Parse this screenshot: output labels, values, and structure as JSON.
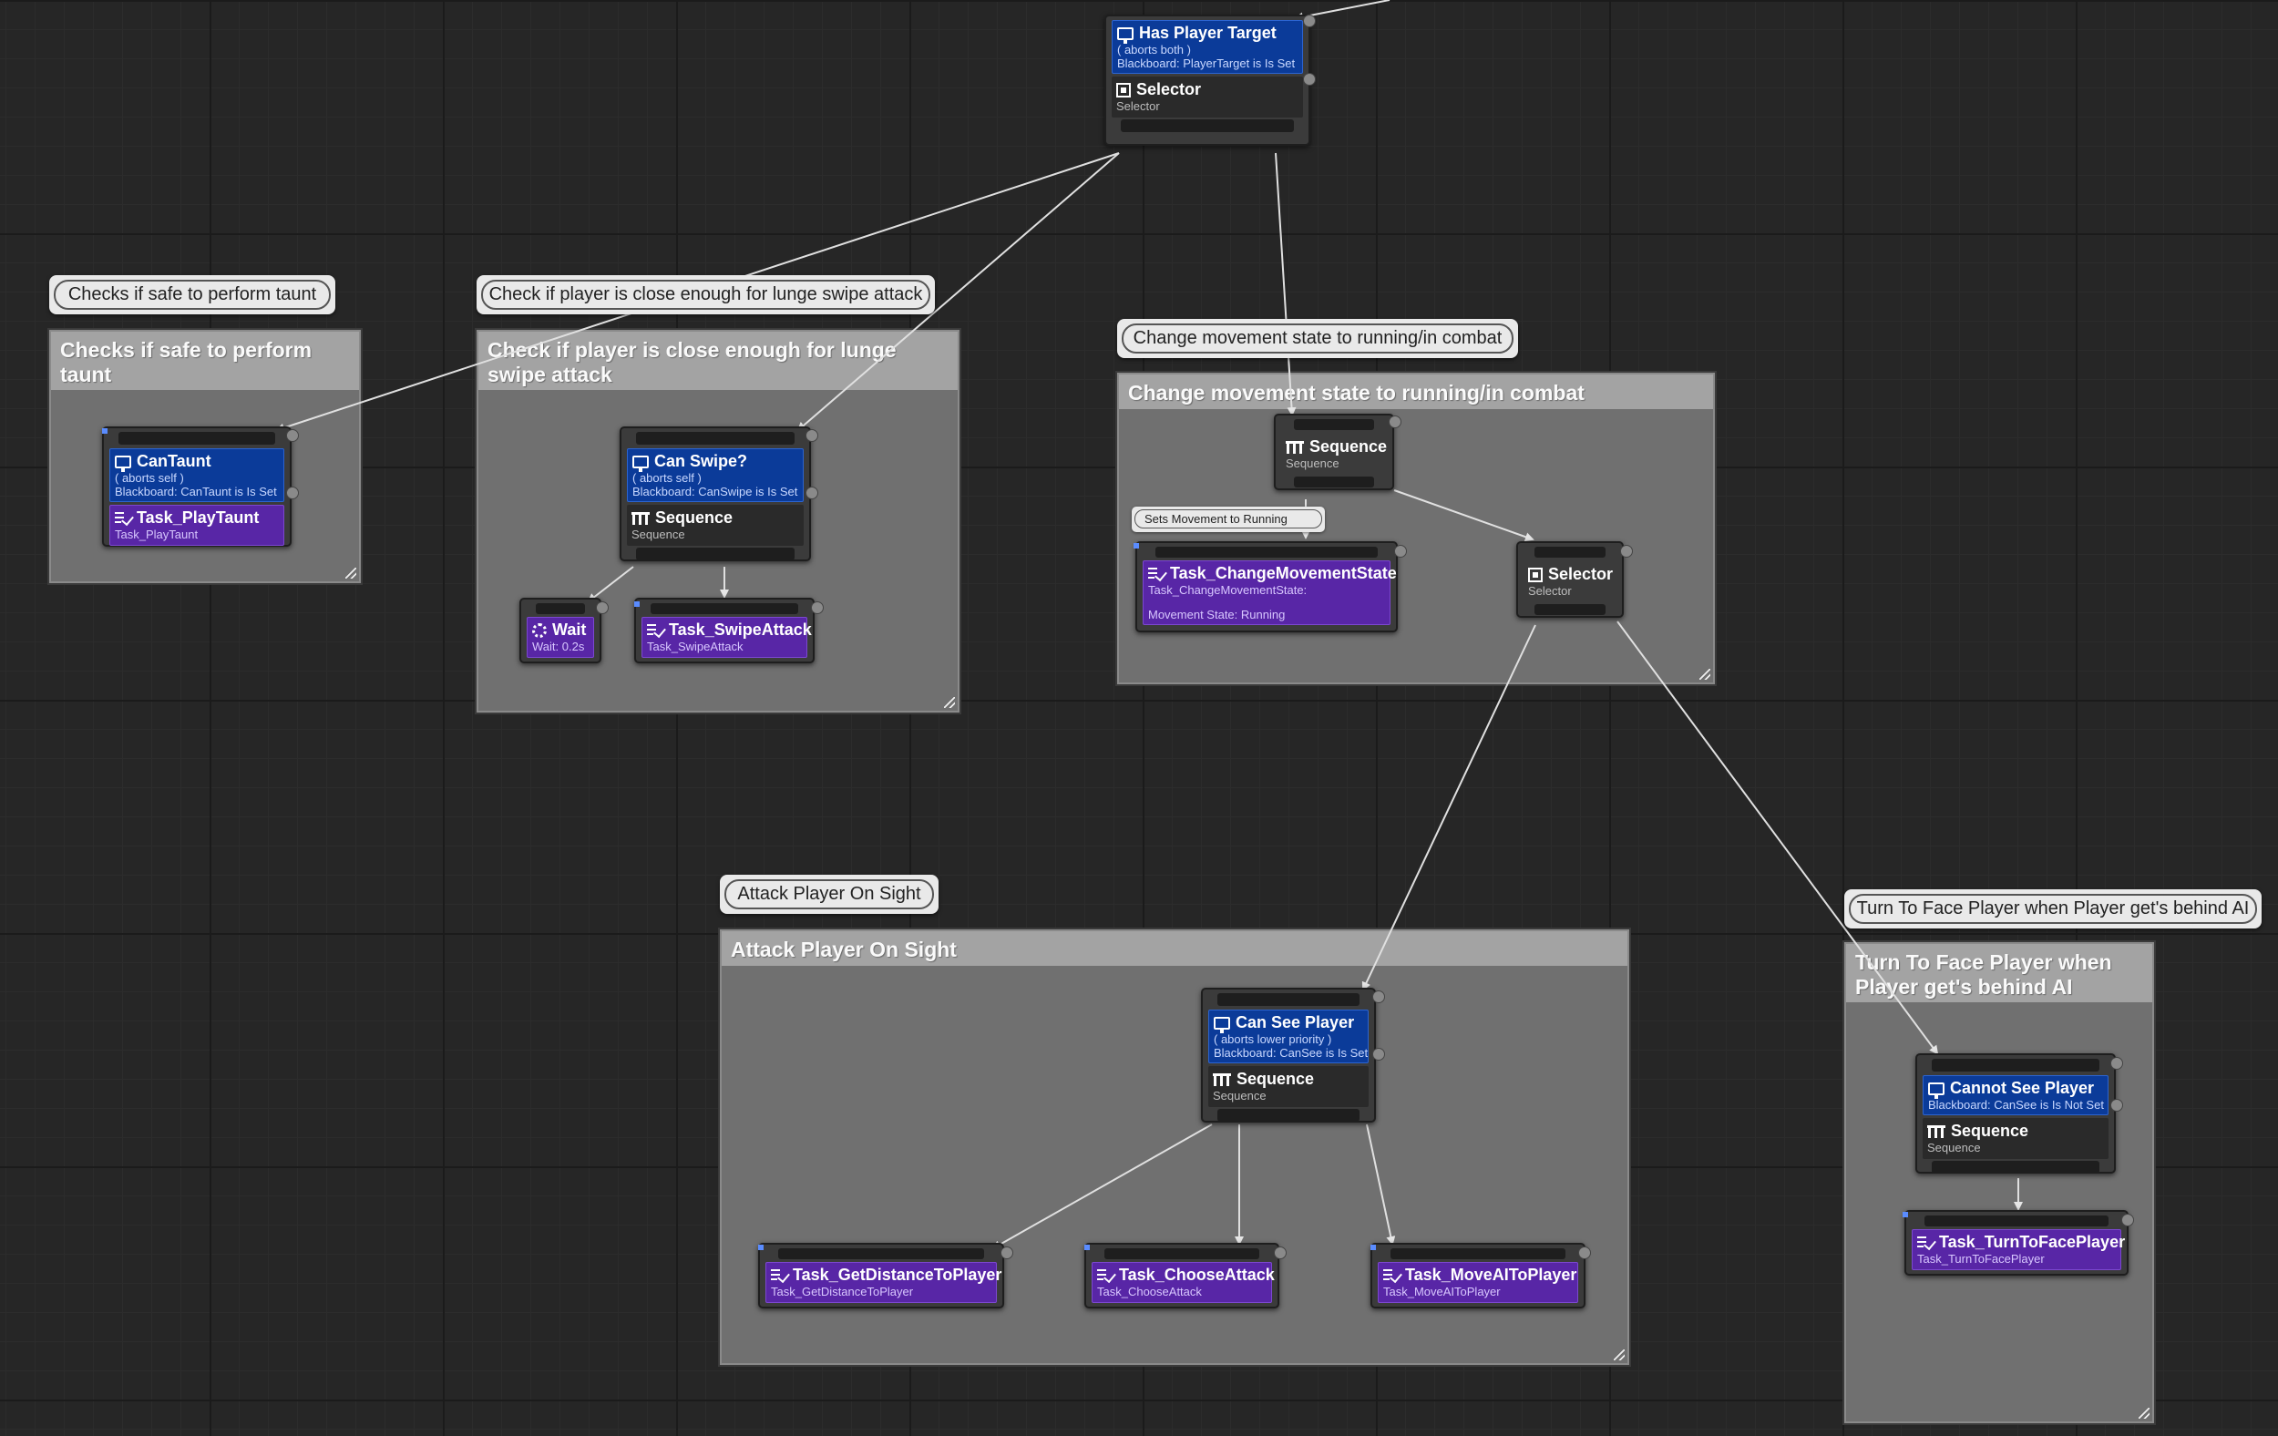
{
  "colors": {
    "graph_background": "#262626",
    "comment_body": "#707070",
    "comment_title": "#a3a3a3",
    "decorator": "#0b3b99",
    "task": "#5826a6",
    "composite": "#2a2a2a"
  },
  "bubbles": {
    "taunt": "Checks if safe to perform taunt",
    "lunge": "Check if player is close enough for lunge swipe attack",
    "movement": "Change movement state to running/in combat",
    "attack": "Attack Player On Sight",
    "turn": "Turn To Face Player when Player get's behind AI",
    "sets_movement": "Sets Movement to Running"
  },
  "comments": {
    "taunt": "Checks if safe to perform taunt",
    "lunge": "Check if player is close enough for lunge swipe attack",
    "movement": "Change movement state to running/in combat",
    "attack": "Attack Player On Sight",
    "turn": "Turn To Face Player when Player get's behind AI"
  },
  "nodes": {
    "root": {
      "decorator_title": "Has Player Target",
      "decorator_abort": "( aborts both )",
      "decorator_condition": "Blackboard: PlayerTarget is Is Set",
      "composite_title": "Selector",
      "composite_sub": "Selector"
    },
    "cantaunt": {
      "decorator_title": "CanTaunt",
      "decorator_abort": "( aborts self )",
      "decorator_condition": "Blackboard: CanTaunt is Is Set",
      "task_title": "Task_PlayTaunt",
      "task_sub": "Task_PlayTaunt"
    },
    "canswipe": {
      "decorator_title": "Can Swipe?",
      "decorator_abort": "( aborts self )",
      "decorator_condition": "Blackboard: CanSwipe is Is Set",
      "composite_title": "Sequence",
      "composite_sub": "Sequence"
    },
    "wait": {
      "title": "Wait",
      "sub": "Wait: 0.2s"
    },
    "swipe": {
      "title": "Task_SwipeAttack",
      "sub": "Task_SwipeAttack"
    },
    "move_seq": {
      "title": "Sequence",
      "sub": "Sequence"
    },
    "change_state": {
      "title": "Task_ChangeMovementState",
      "sub": "Task_ChangeMovementState:",
      "detail": "Movement State: Running"
    },
    "selector2": {
      "title": "Selector",
      "sub": "Selector"
    },
    "cansee": {
      "decorator_title": "Can See Player",
      "decorator_abort": "( aborts lower priority )",
      "decorator_condition": "Blackboard: CanSee is Is Set",
      "composite_title": "Sequence",
      "composite_sub": "Sequence"
    },
    "getdist": {
      "title": "Task_GetDistanceToPlayer",
      "sub": "Task_GetDistanceToPlayer"
    },
    "choose": {
      "title": "Task_ChooseAttack",
      "sub": "Task_ChooseAttack"
    },
    "moveai": {
      "title": "Task_MoveAIToPlayer",
      "sub": "Task_MoveAIToPlayer"
    },
    "cannotsee": {
      "decorator_title": "Cannot See Player",
      "decorator_condition": "Blackboard: CanSee is Is Not Set",
      "composite_title": "Sequence",
      "composite_sub": "Sequence"
    },
    "turnface": {
      "title": "Task_TurnToFacePlayer",
      "sub": "Task_TurnToFacePlayer"
    }
  }
}
